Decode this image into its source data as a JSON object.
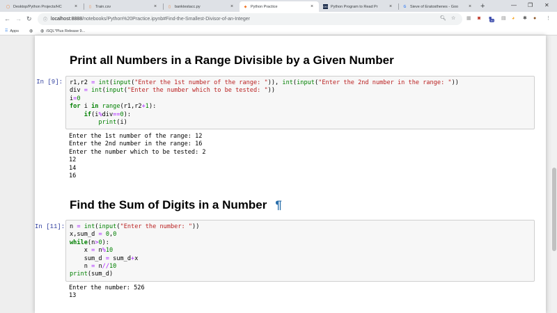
{
  "tabs": [
    {
      "label": "Desktop/Python Projects/HC",
      "icon": "jupyter-icon",
      "active": false
    },
    {
      "label": "Train.csv",
      "icon": "file-icon",
      "active": false
    },
    {
      "label": "banktestacc.py",
      "icon": "file-icon",
      "active": false
    },
    {
      "label": "Python Practice",
      "icon": "notebook-icon",
      "active": true
    },
    {
      "label": "Python Program to Read Pr",
      "icon": "site-icon",
      "active": false
    },
    {
      "label": "Sieve of Eratosthenes - Goo",
      "icon": "google-icon",
      "active": false
    }
  ],
  "address_bar": {
    "host": "localhost:8888",
    "path": "/notebooks/Python%20Practice.ipynb#Find-the-Smallest-Divisor-of-an-Integer"
  },
  "bookmarks": [
    {
      "label": "Apps",
      "icon": "apps-grid-icon"
    },
    {
      "label": "",
      "icon": "globe-icon"
    },
    {
      "label": "iSQL*Plus Release 9...",
      "icon": "globe-icon"
    }
  ],
  "extension_badge": "10",
  "notebook": {
    "section1": {
      "title": "Print all Numbers in a Range Divisible by a Given Number",
      "prompt": "In [9]:",
      "output": "Enter the 1st number of the range: 12\nEnter the 2nd number in the range: 16\nEnter the number which to be tested: 2\n12\n14\n16"
    },
    "section2": {
      "title": "Find the Sum of Digits in a Number",
      "anchor": "¶",
      "prompt": "In [11]:",
      "output": "Enter the number: 526\n13"
    }
  },
  "colors": {
    "prompt": "#303f9f",
    "keyword": "#008000",
    "string": "#ba2121",
    "operator": "#aa22ff",
    "anchor": "#296eaa"
  }
}
